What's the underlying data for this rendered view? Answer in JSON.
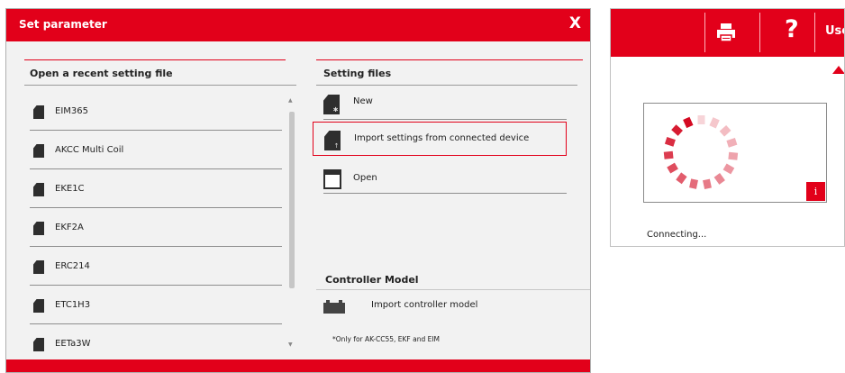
{
  "dialog": {
    "title": "Set parameter",
    "close_label": "X",
    "recent": {
      "heading": "Open a recent setting file",
      "items": [
        "EIM365",
        "AKCC Multi Coil",
        "EKE1C",
        "EKF2A",
        "ERC214",
        "ETC1H3",
        "EETa3W"
      ]
    },
    "setting_files": {
      "heading": "Setting files",
      "new_label": "New",
      "import_label": "Import settings from connected device",
      "open_label": "Open"
    },
    "controller_model": {
      "heading": "Controller Model",
      "import_label": "Import controller model",
      "note": "*Only for AK-CC55, EKF and EIM"
    }
  },
  "connection": {
    "help_label": "?",
    "user_label": "User",
    "info_label": "i",
    "status": "Connecting..."
  },
  "colors": {
    "accent": "#e2001a",
    "panel_bg": "#f2f2f2"
  }
}
